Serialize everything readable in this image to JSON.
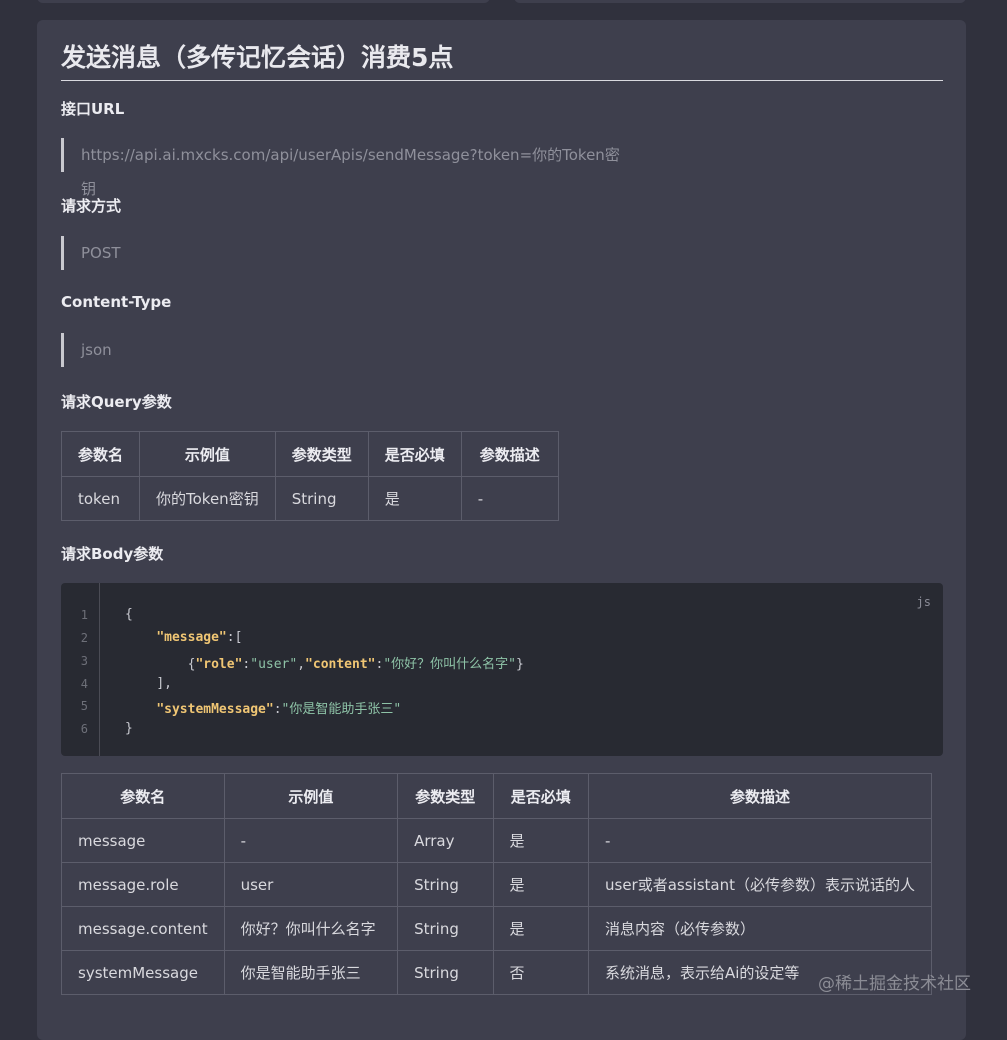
{
  "title": "发送消息（多传记忆会话）消费5点",
  "sections": {
    "url_label": "接口URL",
    "url_value": "https://api.ai.mxcks.com/api/userApis/sendMessage?token=你的Token密钥",
    "method_label": "请求方式",
    "method_value": "POST",
    "ctype_label": "Content-Type",
    "ctype_value": "json",
    "query_label": "请求Query参数",
    "body_label": "请求Body参数"
  },
  "query_table": {
    "headers": [
      "参数名",
      "示例值",
      "参数类型",
      "是否必填",
      "参数描述"
    ],
    "rows": [
      [
        "token",
        "你的Token密钥",
        "String",
        "是",
        "-"
      ]
    ]
  },
  "code": {
    "lang": "js",
    "line_numbers": [
      "1",
      "2",
      "3",
      "4",
      "5",
      "6"
    ],
    "t": {
      "l1": "{",
      "l2_key": "\"message\"",
      "l2_rest": ":[",
      "l3_open": "{",
      "l3_k1": "\"role\"",
      "l3_c1": ":",
      "l3_v1": "\"user\"",
      "l3_comma": ",",
      "l3_k2": "\"content\"",
      "l3_c2": ":",
      "l3_v2": "\"你好？你叫什么名字\"",
      "l3_close": "}",
      "l4": "],",
      "l5_key": "\"systemMessage\"",
      "l5_c": ":",
      "l5_v": "\"你是智能助手张三\"",
      "l6": "}"
    }
  },
  "body_table": {
    "headers": [
      "参数名",
      "示例值",
      "参数类型",
      "是否必填",
      "参数描述"
    ],
    "rows": [
      [
        "message",
        "-",
        "Array",
        "是",
        "-"
      ],
      [
        "message.role",
        "user",
        "String",
        "是",
        "user或者assistant（必传参数）表示说话的人"
      ],
      [
        "message.content",
        "你好？你叫什么名字",
        "String",
        "是",
        "消息内容（必传参数）"
      ],
      [
        "systemMessage",
        "你是智能助手张三",
        "String",
        "否",
        "系统消息，表示给Ai的设定等"
      ]
    ]
  },
  "watermark": "@稀土掘金技术社区"
}
